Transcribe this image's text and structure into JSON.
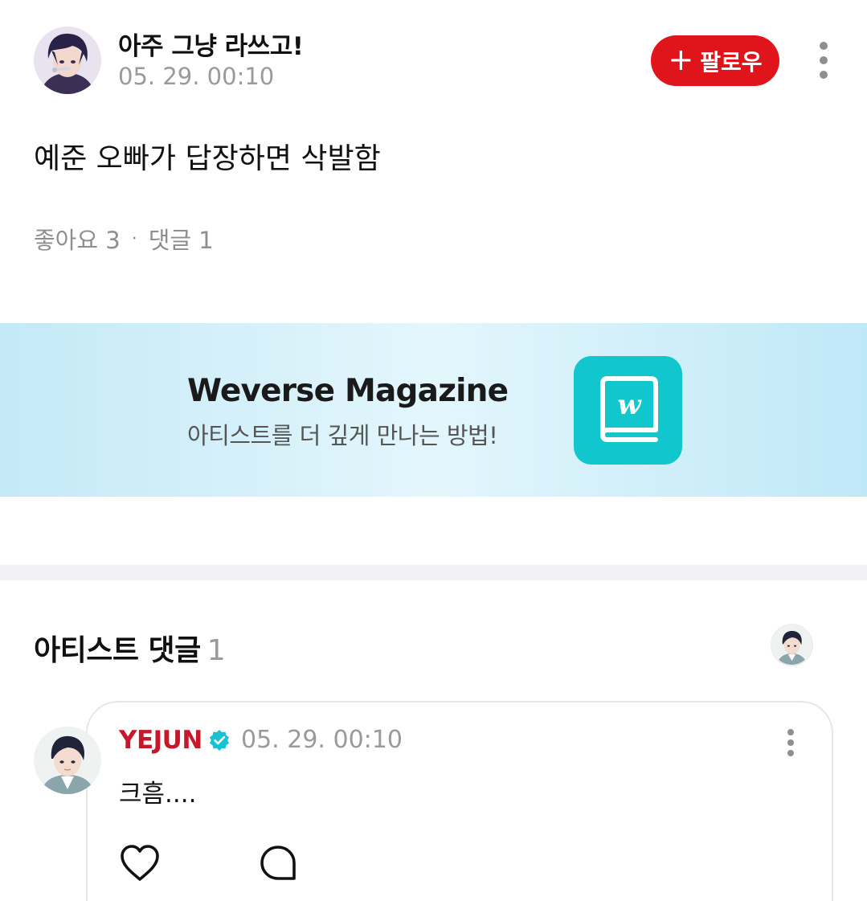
{
  "post": {
    "author": "아주 그냥 라쓰고!",
    "timestamp": "05. 29. 00:10",
    "follow_label": "팔로우",
    "body": "예준 오빠가 답장하면 삭발함",
    "likes_label": "좋아요 3",
    "separator": "·",
    "comments_label": "댓글 1"
  },
  "banner": {
    "title": "Weverse Magazine",
    "subtitle": "아티스트를 더 깊게 만나는 방법!",
    "icon": "weverse-magazine-book-icon"
  },
  "artist_comments": {
    "title": "아티스트 댓글",
    "count": "1",
    "items": [
      {
        "author": "YEJUN",
        "verified_icon": "verified-badge-icon",
        "timestamp": "05. 29. 00:10",
        "text": "크흠....",
        "actions": [
          "heart-icon",
          "comment-bubble-icon"
        ]
      }
    ]
  },
  "colors": {
    "follow_button": "#e0151b",
    "artist_name": "#c8172b",
    "verified_badge": "#17c3d2",
    "banner_icon": "#11c7cd",
    "banner_bg": "#d6f1fb"
  }
}
